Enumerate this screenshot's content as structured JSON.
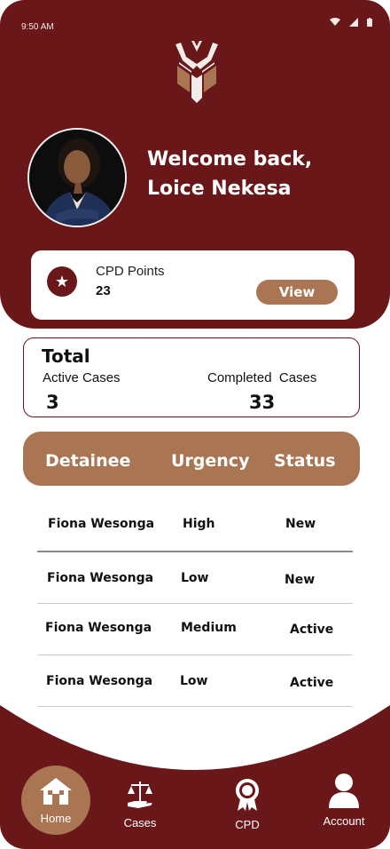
{
  "status_bar": {
    "time": "9:50 AM"
  },
  "profile": {
    "greeting_line1": "Welcome back,",
    "greeting_line2": "Loice Nekesa"
  },
  "cpd": {
    "label": "CPD Points",
    "value": "23",
    "view_label": "View"
  },
  "summary": {
    "title": "Total",
    "active_label": "Active Cases",
    "active_value": "3",
    "completed_label": "Completed  Cases",
    "completed_value": "33"
  },
  "table": {
    "headers": [
      "Detainee",
      "Urgency",
      "Status"
    ],
    "rows": [
      {
        "detainee": "Fiona Wesonga",
        "urgency": "High",
        "status": "New"
      },
      {
        "detainee": "Fiona Wesonga",
        "urgency": "Low",
        "status": "New"
      },
      {
        "detainee": "Fiona Wesonga",
        "urgency": "Medium",
        "status": "Active"
      },
      {
        "detainee": "Fiona Wesonga",
        "urgency": "Low",
        "status": "Active"
      }
    ]
  },
  "nav": {
    "items": [
      {
        "label": "Home",
        "icon": "home-icon",
        "active": true
      },
      {
        "label": "Cases",
        "icon": "scales-icon",
        "active": false
      },
      {
        "label": "CPD",
        "icon": "award-icon",
        "active": false
      },
      {
        "label": "Account",
        "icon": "user-icon",
        "active": false
      }
    ]
  },
  "colors": {
    "primary": "#6a1719",
    "accent": "#a97552",
    "background": "#ffffff"
  }
}
